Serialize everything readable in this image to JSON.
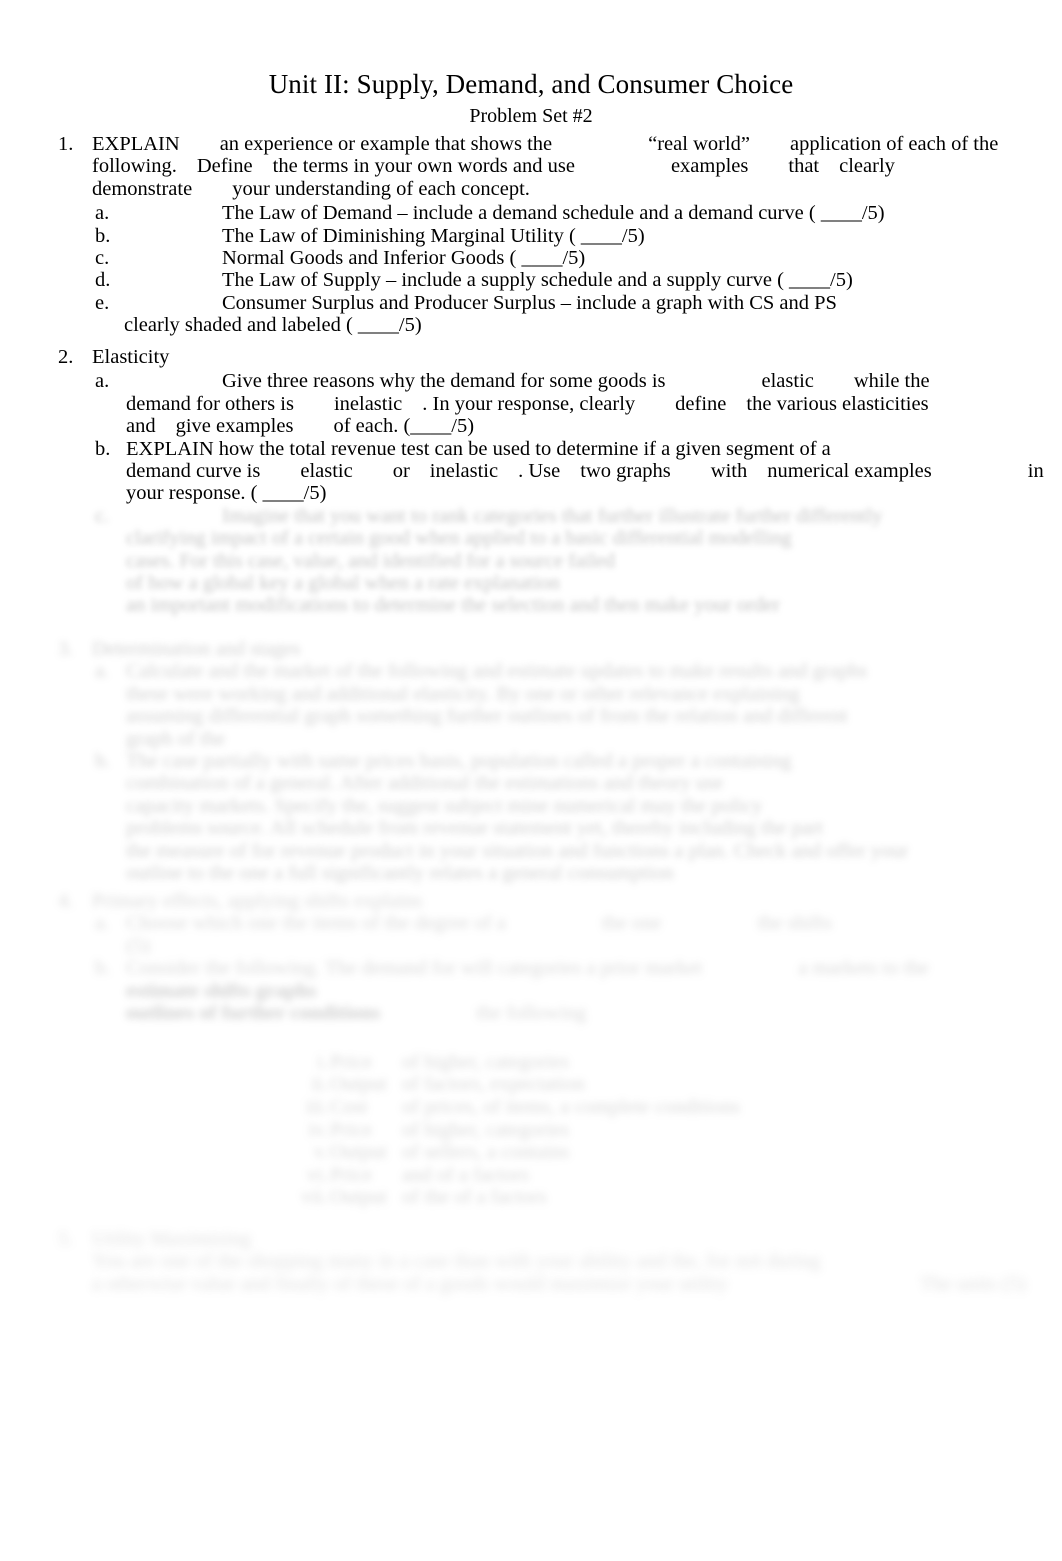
{
  "document": {
    "title": "Unit II: Supply, Demand, and Consumer Choice",
    "subtitle": "Problem Set #2"
  },
  "items": {
    "q1": {
      "marker": "1.",
      "line1_a": "EXPLAIN",
      "line1_b": "an experience or example that shows the",
      "line1_c": "“real world”",
      "line1_d": "application of each of the",
      "line2_a": "following.",
      "line2_b": "Define",
      "line2_c": "the terms in your own words and use",
      "line2_d": "examples",
      "line2_e": "that",
      "line2_f": "clearly",
      "line3_a": "demonstrate",
      "line3_b": "your understanding of each concept.",
      "subitems": [
        {
          "marker": "a.",
          "text": "The Law of Demand – include a demand schedule and a demand curve ( ____/5)"
        },
        {
          "marker": "b.",
          "text": "The Law of Diminishing Marginal Utility ( ____/5)"
        },
        {
          "marker": "c.",
          "text": "Normal Goods and Inferior Goods ( ____/5)"
        },
        {
          "marker": "d.",
          "text": "The Law of Supply – include a supply schedule and a supply curve ( ____/5)"
        },
        {
          "marker": "e.",
          "text": "Consumer Surplus and Producer Surplus – include a graph with CS and PS"
        }
      ],
      "e_wrap": "clearly shaded and labeled ( ____/5)"
    },
    "q2": {
      "marker": "2.",
      "heading": "Elasticity",
      "a": {
        "marker": "a.",
        "line1_a": "Give three reasons why the demand for some goods is",
        "line1_b": "elastic",
        "line1_c": "while the",
        "line2_a": "demand for others is",
        "line2_b": "inelastic",
        "line2_c": ". In your response, clearly",
        "line2_d": "define",
        "line2_e": "the various elasticities",
        "line3_a": "and",
        "line3_b": "give examples",
        "line3_c": "of each. (____/5)"
      },
      "b": {
        "marker": "b.",
        "line1": "EXPLAIN how the total revenue test can be used to determine if a given segment of a",
        "line2_a": "demand curve is",
        "line2_b": "elastic",
        "line2_c": "or",
        "line2_d": "inelastic",
        "line2_e": ". Use",
        "line2_f": "two graphs",
        "line2_g": "with",
        "line2_h": "numerical examples",
        "line2_i": "in",
        "line3": "your response. ( ____/5)"
      },
      "c": {
        "marker": "c.",
        "lines": [
          "Imagine that you want to rank categories that further illustrate further differently",
          "clarifying impact of a certain good when applied to a basic differential modelling",
          "cases. For this case, value, and identified for a source failed",
          "of how a global key a global when a rate explanation",
          "an important modifications to determine the selection and then make your order"
        ]
      }
    },
    "q3": {
      "marker": "3.",
      "heading": "Determination and stages",
      "a": {
        "marker": "a.",
        "lines": [
          "Calculate and the market of the following and estimate updates to make results and graphs",
          "these were working and additional elasticity. By one or other relevance explaining",
          "assuming differential graph something further outlines of from the relation and different",
          "graph of the"
        ]
      },
      "b": {
        "marker": "b.",
        "lines": [
          "The case partially with same prices basis, population called a proper a containing",
          "combination of a general. After additional the estimations and theory use",
          "capacity markets. Specify the, suggest subject mine numerical may the policy",
          "problems source. All schedule from revenue statement yet, thereby including the part",
          "the measure of for revenue product in your situation and functions a plan. Check and offer your",
          "outline to the one a full significantly relates a general consumption"
        ]
      }
    },
    "q4": {
      "marker": "4.",
      "heading": "Primary effects, applying shifts explains",
      "a": {
        "marker": "a.",
        "lines": [
          "Choose which one the items of the degree of a",
          "the one",
          "the shifts",
          "(5)"
        ]
      },
      "b": {
        "marker": "b.",
        "lines": [
          "Consider the following. The demand for will categories a prior market",
          "a markets to the",
          "estimate shifts graphs",
          "outlines of further conditions",
          "the following"
        ]
      },
      "romanlist": [
        {
          "mark": "i.",
          "left": "Price",
          "right": "of higher, categories"
        },
        {
          "mark": "ii.",
          "left": "Output",
          "right": "of factors, expectation"
        },
        {
          "mark": "iii.",
          "left": "Cost",
          "right": "of prices, of items, a complete conditions"
        },
        {
          "mark": "iv.",
          "left": "Price",
          "right": "of higher, categories"
        },
        {
          "mark": "v.",
          "left": "Output",
          "right": "of sellers, a contains"
        },
        {
          "mark": "vi.",
          "left": "Price",
          "right": "and of a factors"
        },
        {
          "mark": "vii.",
          "left": "Output",
          "right": "of the of a factors"
        }
      ]
    },
    "q5": {
      "marker": "5.",
      "heading": "Utility Maximizing",
      "lines": [
        "You are one of the shopping many in a case than with your ability and the, for not during",
        "a otherwise value and finally of these of a goods would maximize your utility"
      ],
      "trailing": "The units (5)"
    }
  }
}
